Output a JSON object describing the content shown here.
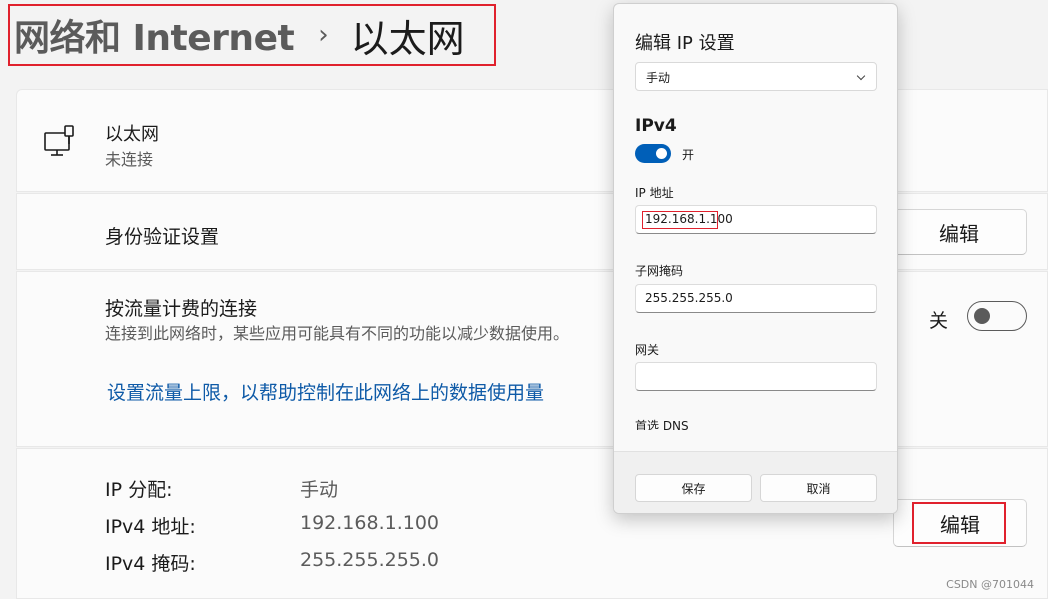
{
  "breadcrumb": {
    "parent": "网络和 Internet",
    "separator": "›",
    "current": "以太网"
  },
  "ethernet": {
    "title": "以太网",
    "status": "未连接",
    "icon": "ethernet-computer-icon"
  },
  "auth": {
    "title": "身份验证设置",
    "edit_label": "编辑"
  },
  "metered": {
    "title": "按流量计费的连接",
    "description": "连接到此网络时，某些应用可能具有不同的功能以减少数据使用。",
    "toggle_label": "关",
    "toggle_on": false,
    "link": "设置流量上限，以帮助控制在此网络上的数据使用量"
  },
  "ip_info": {
    "rows": [
      {
        "label": "IP 分配:",
        "value": "手动"
      },
      {
        "label": "IPv4 地址:",
        "value": "192.168.1.100"
      },
      {
        "label": "IPv4 掩码:",
        "value": "255.255.255.0"
      }
    ],
    "edit_label": "编辑"
  },
  "dialog": {
    "title": "编辑 IP 设置",
    "mode": "手动",
    "section": "IPv4",
    "toggle_label": "开",
    "toggle_on": true,
    "ip_label": "IP 地址",
    "ip_value": "192.168.1.100",
    "mask_label": "子网掩码",
    "mask_value": "255.255.255.0",
    "gateway_label": "网关",
    "gateway_value": "",
    "dns_label": "首选 DNS",
    "save_label": "保存",
    "cancel_label": "取消"
  },
  "watermark": "CSDN @701044",
  "colors": {
    "accent": "#005fb8",
    "link": "#0e5aa7",
    "highlight": "#e0212d"
  }
}
